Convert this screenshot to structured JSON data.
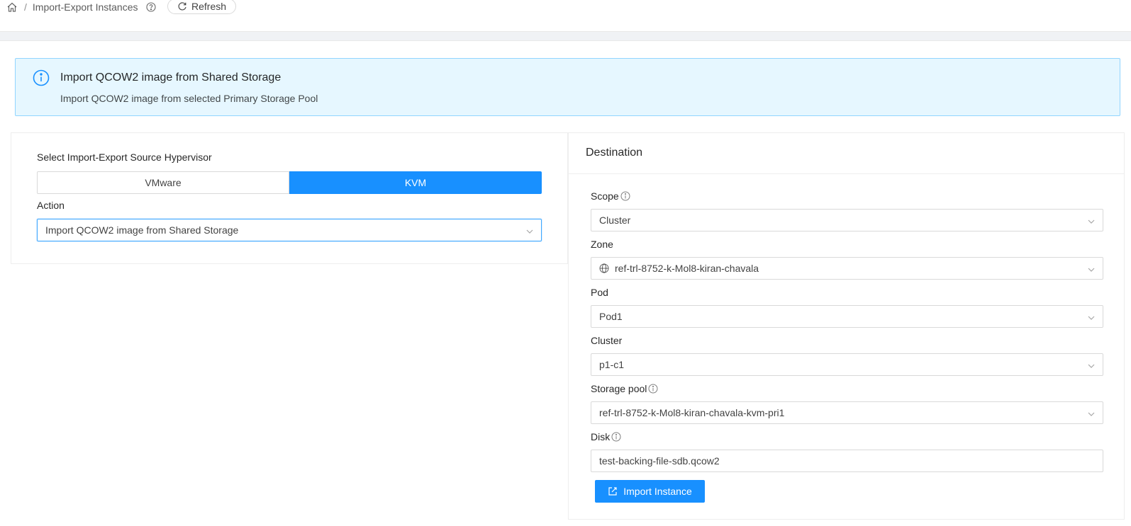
{
  "header": {
    "breadcrumb_separator": "/",
    "page_title": "Import-Export Instances",
    "refresh_label": "Refresh"
  },
  "alert": {
    "title": "Import QCOW2 image from Shared Storage",
    "description": "Import QCOW2 image from selected Primary Storage Pool"
  },
  "source": {
    "hypervisor_label": "Select Import-Export Source Hypervisor",
    "hypervisor_options": [
      "VMware",
      "KVM"
    ],
    "selected_hypervisor": "KVM",
    "action_label": "Action",
    "action_value": "Import QCOW2 image from Shared Storage"
  },
  "destination": {
    "title": "Destination",
    "scope_label": "Scope",
    "scope_value": "Cluster",
    "zone_label": "Zone",
    "zone_value": "ref-trl-8752-k-Mol8-kiran-chavala",
    "pod_label": "Pod",
    "pod_value": "Pod1",
    "cluster_label": "Cluster",
    "cluster_value": "p1-c1",
    "storage_pool_label": "Storage pool",
    "storage_pool_value": "ref-trl-8752-k-Mol8-kiran-chavala-kvm-pri1",
    "disk_label": "Disk",
    "disk_value": "test-backing-file-sdb.qcow2",
    "import_button_label": "Import Instance"
  },
  "colors": {
    "primary": "#1890ff",
    "alert_bg": "#e6f7ff",
    "alert_border": "#91d5ff"
  }
}
